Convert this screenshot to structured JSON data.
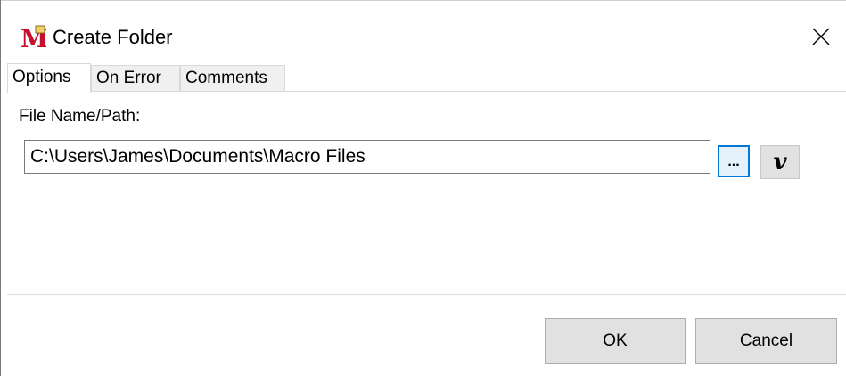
{
  "window": {
    "title": "Create Folder",
    "icon": "macro-m-icon",
    "close_icon": "close-icon"
  },
  "tabs": [
    {
      "label": "Options",
      "active": true
    },
    {
      "label": "On Error",
      "active": false
    },
    {
      "label": "Comments",
      "active": false
    }
  ],
  "options": {
    "file_label": "File Name/Path:",
    "file_value": "C:\\Users\\James\\Documents\\Macro Files",
    "browse_label": "...",
    "variable_label": "v"
  },
  "footer": {
    "ok_label": "OK",
    "cancel_label": "Cancel"
  },
  "colors": {
    "icon_red": "#c8102e",
    "focus_blue": "#0078d7",
    "button_gray": "#e1e1e1"
  }
}
